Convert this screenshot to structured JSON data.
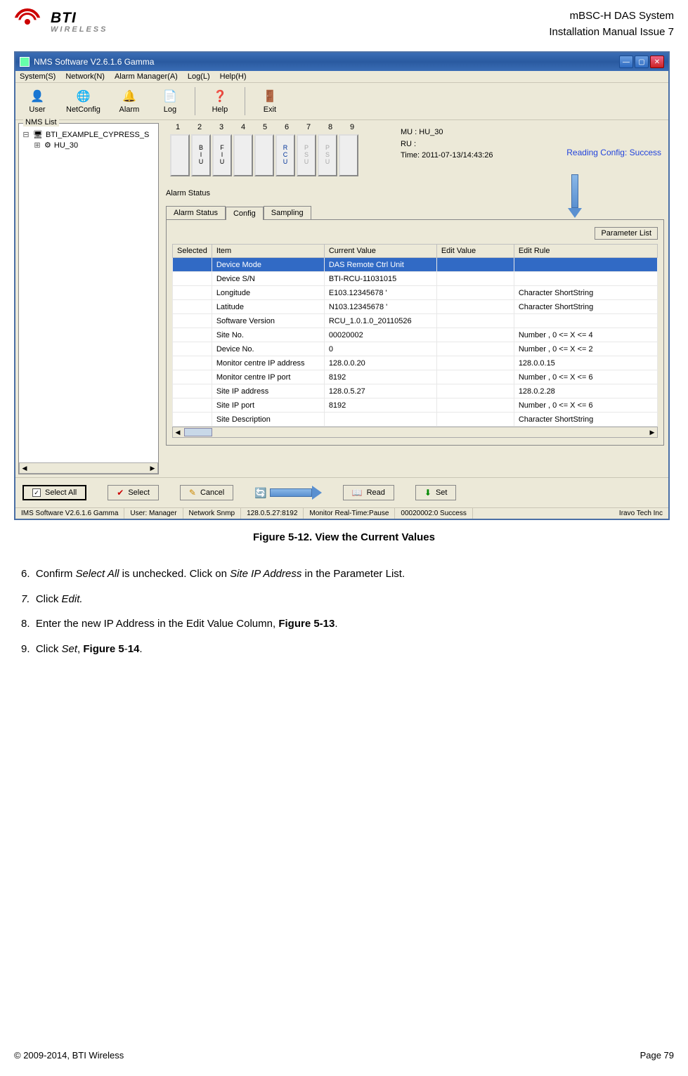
{
  "header": {
    "brand_main": "BTI",
    "brand_sub": "WIRELESS",
    "doc_line1": "mBSC-H DAS System",
    "doc_line2": "Installation Manual Issue 7"
  },
  "app": {
    "window_title": "NMS Software V2.6.1.6 Gamma",
    "menus": [
      "System(S)",
      "Network(N)",
      "Alarm Manager(A)",
      "Log(L)",
      "Help(H)"
    ],
    "toolbar": [
      {
        "icon": "👤",
        "label": "User",
        "name": "user-button"
      },
      {
        "icon": "🌐",
        "label": "NetConfig",
        "name": "netconfig-button"
      },
      {
        "icon": "🔔",
        "label": "Alarm",
        "name": "alarm-button"
      },
      {
        "icon": "📄",
        "label": "Log",
        "name": "log-button"
      },
      {
        "sep": true
      },
      {
        "icon": "❓",
        "label": "Help",
        "name": "help-button"
      },
      {
        "sep": true
      },
      {
        "icon": "🚪",
        "label": "Exit",
        "name": "exit-button"
      }
    ],
    "nms_list_title": "NMS List",
    "tree": {
      "root": "BTI_EXAMPLE_CYPRESS_S",
      "child": "HU_30"
    },
    "slot_numbers": [
      "1",
      "2",
      "3",
      "4",
      "5",
      "6",
      "7",
      "8",
      "9"
    ],
    "slots": [
      {
        "label": "",
        "cls": ""
      },
      {
        "label": "B\nI\nU",
        "cls": ""
      },
      {
        "label": "F\nI\nU",
        "cls": ""
      },
      {
        "label": "",
        "cls": ""
      },
      {
        "label": "",
        "cls": ""
      },
      {
        "label": "R\nC\nU",
        "cls": "active"
      },
      {
        "label": "P\nS\nU",
        "cls": "gray"
      },
      {
        "label": "P\nS\nU",
        "cls": "gray"
      },
      {
        "label": "",
        "cls": ""
      }
    ],
    "info": {
      "mu_label": "MU :",
      "mu_value": "HU_30",
      "ru_label": "RU :",
      "ru_value": "",
      "time_label": "Time:",
      "time_value": "2011-07-13/14:43:26"
    },
    "reading_status": "Reading Config: Success",
    "tabs": [
      "Alarm Status",
      "Config",
      "Sampling"
    ],
    "active_tab": "Config",
    "param_list_btn": "Parameter List",
    "table": {
      "headers": [
        "Selected",
        "Item",
        "Current Value",
        "Edit Value",
        "Edit Rule"
      ],
      "rows": [
        {
          "selected": true,
          "item": "Device Mode",
          "current": "DAS Remote Ctrl Unit",
          "edit": "",
          "rule": ""
        },
        {
          "selected": false,
          "item": "Device S/N",
          "current": "BTI-RCU-11031015",
          "edit": "",
          "rule": ""
        },
        {
          "selected": false,
          "item": "Longitude",
          "current": "E103.12345678 '",
          "edit": "",
          "rule": "Character ShortString"
        },
        {
          "selected": false,
          "item": "Latitude",
          "current": "N103.12345678 '",
          "edit": "",
          "rule": "Character ShortString"
        },
        {
          "selected": false,
          "item": "Software Version",
          "current": "RCU_1.0.1.0_20110526",
          "edit": "",
          "rule": ""
        },
        {
          "selected": false,
          "item": "Site No.",
          "current": "00020002",
          "edit": "",
          "rule": "Number , 0 <= X <= 4"
        },
        {
          "selected": false,
          "item": "Device No.",
          "current": "0",
          "edit": "",
          "rule": "Number , 0 <= X <= 2"
        },
        {
          "selected": false,
          "item": "Monitor centre IP address",
          "current": "128.0.0.20",
          "edit": "",
          "rule": "128.0.0.15"
        },
        {
          "selected": false,
          "item": "Monitor centre IP port",
          "current": "8192",
          "edit": "",
          "rule": "Number , 0 <= X <= 6"
        },
        {
          "selected": false,
          "item": "Site IP address",
          "current": "128.0.5.27",
          "edit": "",
          "rule": "128.0.2.28"
        },
        {
          "selected": false,
          "item": "Site IP port",
          "current": "8192",
          "edit": "",
          "rule": "Number , 0 <= X <= 6"
        },
        {
          "selected": false,
          "item": "Site Description",
          "current": "",
          "edit": "",
          "rule": "Character ShortString"
        }
      ]
    },
    "footer_buttons": {
      "select_all": {
        "label": "Select All",
        "checked": true
      },
      "select": "Select",
      "cancel": "Cancel",
      "read": "Read",
      "set": "Set"
    },
    "statusbar": [
      "IMS Software V2.6.1.6 Gamma",
      "User: Manager",
      "Network Snmp",
      "128.0.5.27:8192",
      "Monitor Real-Time:Pause",
      "00020002:0 Success",
      "Iravo Tech Inc"
    ]
  },
  "figure_caption": "Figure 5-12. View the Current Values",
  "instructions": [
    {
      "num": "6.",
      "text": "Confirm <i>Select All</i> is unchecked. Click on <i>Site IP Address</i> in the Parameter List."
    },
    {
      "num": "7.",
      "text": "Click <i>Edit.</i>",
      "italic_num": true
    },
    {
      "num": "8.",
      "text": "Enter the new IP Address in the Edit Value Column, <b>Figure 5-13</b>."
    },
    {
      "num": "9.",
      "text": "Click <i>Set</i>, <b>Figure 5</b>-<b>14</b>."
    }
  ],
  "footer": {
    "copyright": "© 2009-2014, BTI Wireless",
    "page": "Page 79"
  }
}
